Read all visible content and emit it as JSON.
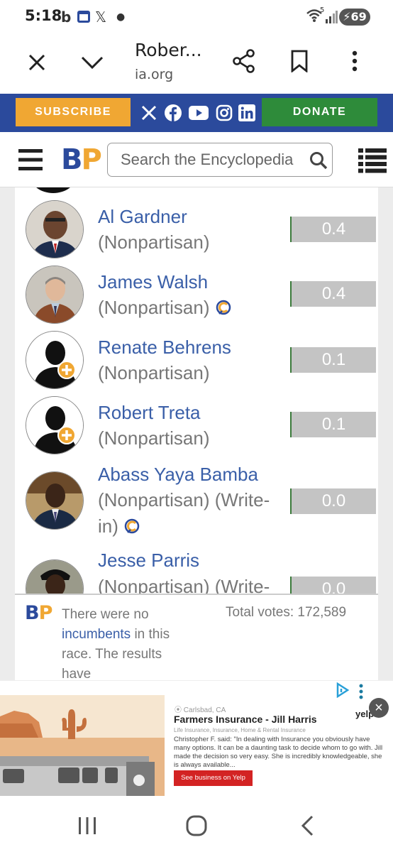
{
  "status_bar": {
    "time": "5:18",
    "battery": "69",
    "wifi_label": "5",
    "icons": [
      "bing-icon",
      "calendar-icon",
      "x-icon",
      "dot-icon",
      "wifi-icon",
      "signal-icon",
      "battery-icon"
    ]
  },
  "browser": {
    "title": "Rober...",
    "domain": "ia.org"
  },
  "bp_bar": {
    "subscribe": "SUBSCRIBE",
    "donate": "DONATE",
    "social_icons": [
      "x-icon",
      "facebook-icon",
      "youtube-icon",
      "instagram-icon",
      "linkedin-icon"
    ]
  },
  "header": {
    "logo_b": "B",
    "logo_p": "P",
    "search_placeholder": "Search the Encyclopedia"
  },
  "candidates": [
    {
      "name": "Al Gardner",
      "party": "(Nonpartisan)",
      "pct": "0.4",
      "icon": ""
    },
    {
      "name": "James Walsh",
      "party": "(Nonpartisan)",
      "pct": "0.4",
      "icon": "candidate-connection-icon"
    },
    {
      "name": "Renate Behrens",
      "party": "(Nonpartisan)",
      "pct": "0.1",
      "icon": ""
    },
    {
      "name": "Robert Treta",
      "party": "(Nonpartisan)",
      "pct": "0.1",
      "icon": ""
    },
    {
      "name": "Abass Yaya Bamba",
      "party": "(Nonpartisan) (Write-in)",
      "pct": "0.0",
      "icon": "candidate-connection-icon"
    },
    {
      "name": "Jesse Parris",
      "party": "(Nonpartisan) (Write-",
      "pct": "0.0",
      "icon": ""
    }
  ],
  "footer": {
    "note_pre": "There were no",
    "note_link": "incumbents",
    "note_post": "in this race. The results have",
    "total_votes": "Total votes: 172,589"
  },
  "ad": {
    "location": "Carlsbad, CA",
    "title": "Farmers Insurance - Jill Harris",
    "subtitle": "Life Insurance, Insurance, Home & Rental Insurance",
    "body": "Christopher F. said: \"In dealing with Insurance you obviously have many options. It can be a daunting task to decide whom to go with. Jill made the decision so very easy. She is incredibly knowledgeable, she is always available...",
    "cta": "See business on Yelp",
    "brand": "yelp",
    "close": "×"
  }
}
